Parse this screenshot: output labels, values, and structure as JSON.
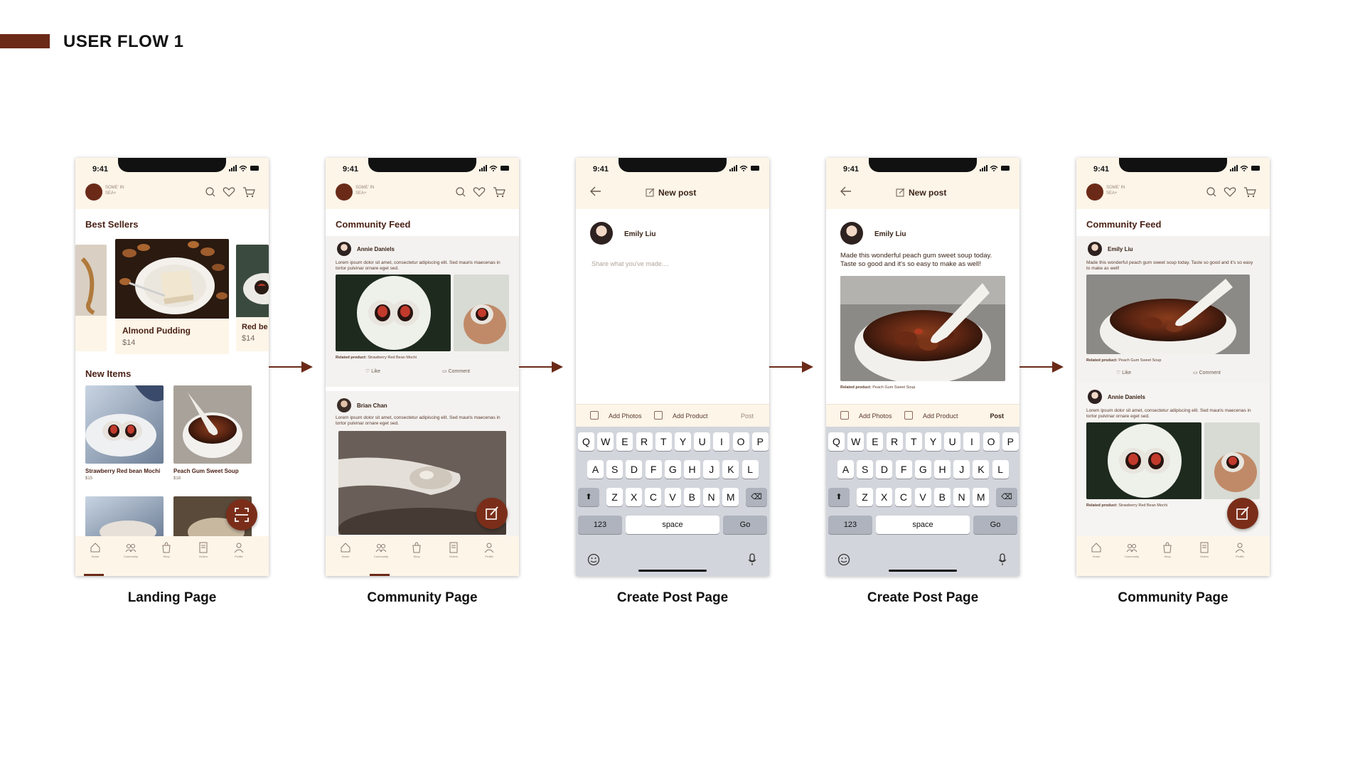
{
  "header": {
    "title": "USER FLOW 1"
  },
  "colors": {
    "brand": "#6b2a18",
    "cream": "#fdf5e8",
    "arrow": "#6b2a18"
  },
  "status": {
    "time": "9:41"
  },
  "app": {
    "logo_text": "SOME' IN\nSEA+",
    "tabs": [
      "Home",
      "Community",
      "Shop",
      "Orders",
      "Profile"
    ],
    "icons": [
      "search-icon",
      "heart-icon",
      "cart-icon"
    ]
  },
  "screens": {
    "landing": {
      "caption": "Landing Page",
      "best_sellers": "Best Sellers",
      "featured": {
        "name": "Almond Pudding",
        "price": "$14"
      },
      "peek": {
        "name": "Red be",
        "price": "$14"
      },
      "new_items": "New Items",
      "items": [
        {
          "name": "Strawberry Red bean Mochi",
          "price": "$15"
        },
        {
          "name": "Peach Gum Sweet Soup",
          "price": "$18"
        }
      ]
    },
    "community1": {
      "caption": "Community Page",
      "title": "Community Feed",
      "posts": [
        {
          "author": "Annie Daniels",
          "body": "Lorem ipsum dolor sit amet, consectetur adipiscing elit. Sed mauris maecenas in tortor pulvinar ornare eget sed.",
          "related_label": "Related product:",
          "related": "Strawberry Red Bean Mochi",
          "like": "Like",
          "comment": "Comment"
        },
        {
          "author": "Brian Chan",
          "body": "Lorem ipsum dolor sit amet, consectetur adipiscing elit. Sed mauris maecenas in tortor pulvinar ornare eget sed."
        }
      ]
    },
    "create1": {
      "caption": "Create Post Page",
      "title": "New post",
      "user": "Emily Liu",
      "placeholder": "Share what you've made....",
      "add_photos": "Add Photos",
      "add_product": "Add Product",
      "post": "Post"
    },
    "create2": {
      "caption": "Create Post Page",
      "title": "New post",
      "user": "Emily Liu",
      "text": "Made this wonderful peach gum sweet soup today. Taste so good and it's so easy to make as well!",
      "related_label": "Related product:",
      "related": "Peach Gum Sweet Soup",
      "add_photos": "Add Photos",
      "add_product": "Add Product",
      "post": "Post"
    },
    "community2": {
      "caption": "Community Page",
      "title": "Community Feed",
      "posts": [
        {
          "author": "Emily Liu",
          "body": "Made this wonderful peach gum sweet soup today. Taste so good and it's so easy to make as well!",
          "related_label": "Related product:",
          "related": "Peach Gum Sweet Soup",
          "like": "Like",
          "comment": "Comment"
        },
        {
          "author": "Annie Daniels",
          "body": "Lorem ipsum dolor sit amet, consectetur adipiscing elit. Sed mauris maecenas in tortor pulvinar ornare eget sed.",
          "related_label": "Related product:",
          "related": "Strawberry Red Bean Mochi"
        }
      ]
    }
  },
  "keyboard": {
    "row1": [
      "Q",
      "W",
      "E",
      "R",
      "T",
      "Y",
      "U",
      "I",
      "O",
      "P"
    ],
    "row2": [
      "A",
      "S",
      "D",
      "F",
      "G",
      "H",
      "J",
      "K",
      "L"
    ],
    "row3": [
      "Z",
      "X",
      "C",
      "V",
      "B",
      "N",
      "M"
    ],
    "numbers": "123",
    "space": "space",
    "go": "Go"
  }
}
